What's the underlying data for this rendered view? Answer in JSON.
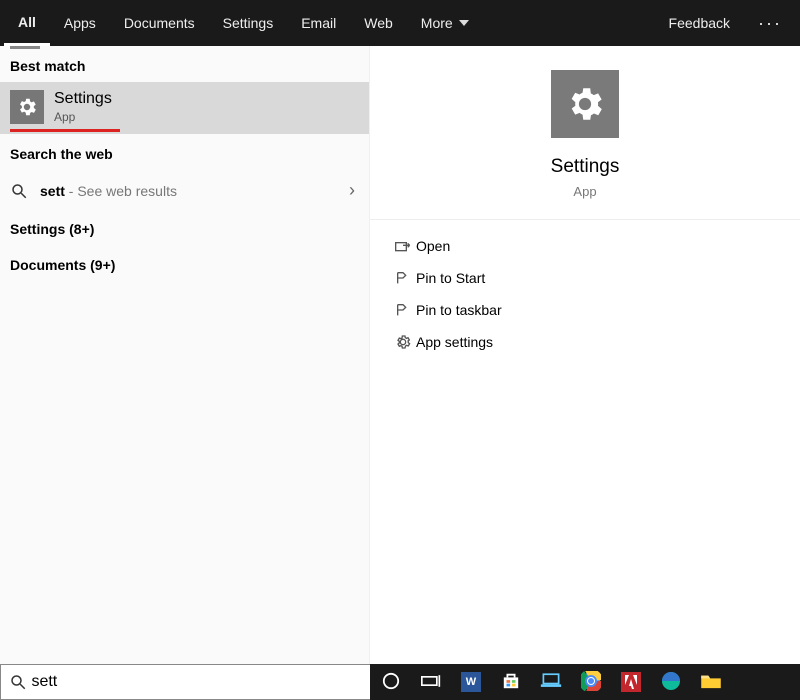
{
  "tabs": {
    "items": [
      "All",
      "Apps",
      "Documents",
      "Settings",
      "Email",
      "Web",
      "More"
    ],
    "active_index": 0,
    "feedback": "Feedback"
  },
  "left": {
    "best_match_label": "Best match",
    "best_match": {
      "title": "Settings",
      "subtitle": "App"
    },
    "search_web_label": "Search the web",
    "web_query": "sett",
    "web_hint": " - See web results",
    "categories": [
      {
        "label": "Settings (8+)"
      },
      {
        "label": "Documents (9+)"
      }
    ]
  },
  "preview": {
    "title": "Settings",
    "subtitle": "App",
    "actions": [
      {
        "icon": "open-icon",
        "label": "Open"
      },
      {
        "icon": "pin-start-icon",
        "label": "Pin to Start"
      },
      {
        "icon": "pin-task-icon",
        "label": "Pin to taskbar"
      },
      {
        "icon": "gear-icon",
        "label": "App settings"
      }
    ]
  },
  "search": {
    "value": "sett"
  },
  "taskbar_items": [
    "cortana",
    "task-view",
    "word",
    "store",
    "laptop",
    "chrome",
    "adobe",
    "edge",
    "file-explorer"
  ]
}
